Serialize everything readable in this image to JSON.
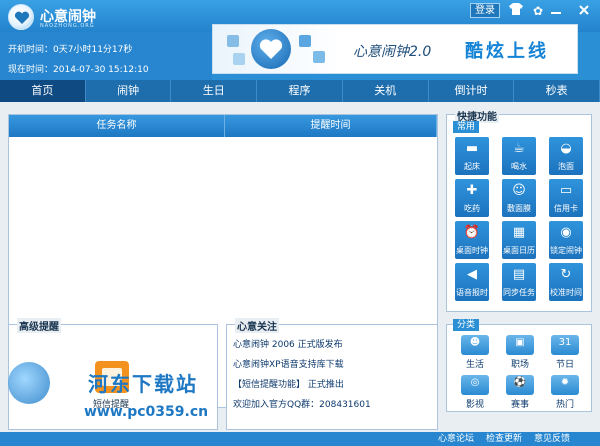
{
  "app": {
    "title": "心意闹钟",
    "subtitle": "NAOZHONG.ORG",
    "login_label": "登录"
  },
  "info": {
    "uptime_label": "开机时间：",
    "uptime_value": "0天7小时11分17秒",
    "now_label": "现在时间：",
    "now_value": "2014-07-30 15:12:10"
  },
  "banner": {
    "text1": "心意闹钟2.0",
    "text2": "酷炫上线"
  },
  "nav": {
    "items": [
      "首页",
      "闹钟",
      "生日",
      "程序",
      "关机",
      "倒计时",
      "秒表"
    ]
  },
  "task_list": {
    "col_name": "任务名称",
    "col_time": "提醒时间"
  },
  "advanced": {
    "title": "高级提醒",
    "sms_label": "短信提醒"
  },
  "news": {
    "title": "心意关注",
    "items": [
      "心意闹钟 2006 正式版发布",
      "心意闹钟XP语音支持库下载",
      "【短信提醒功能】 正式推出",
      "欢迎加入官方QQ群：208431601"
    ]
  },
  "quick": {
    "title": "快捷功能",
    "common_tag": "常用",
    "buttons": [
      "起床",
      "喝水",
      "泡面",
      "吃药",
      "敷面膜",
      "信用卡",
      "桌面时钟",
      "桌面日历",
      "锁定闹钟",
      "语音报时",
      "同步任务",
      "校准时间"
    ]
  },
  "categories": {
    "tag": "分类",
    "items": [
      "生活",
      "职场",
      "节日",
      "影视",
      "赛事",
      "热门"
    ]
  },
  "footer": {
    "forum": "心意论坛",
    "update": "检查更新",
    "feedback": "意见反馈"
  },
  "watermark": {
    "text1": "河东下载站",
    "text2": "www.pc0359.cn"
  },
  "colors": {
    "accent": "#2a8fd4",
    "nav_active": "#0f4a82",
    "sms_orange": "#f3921f"
  }
}
